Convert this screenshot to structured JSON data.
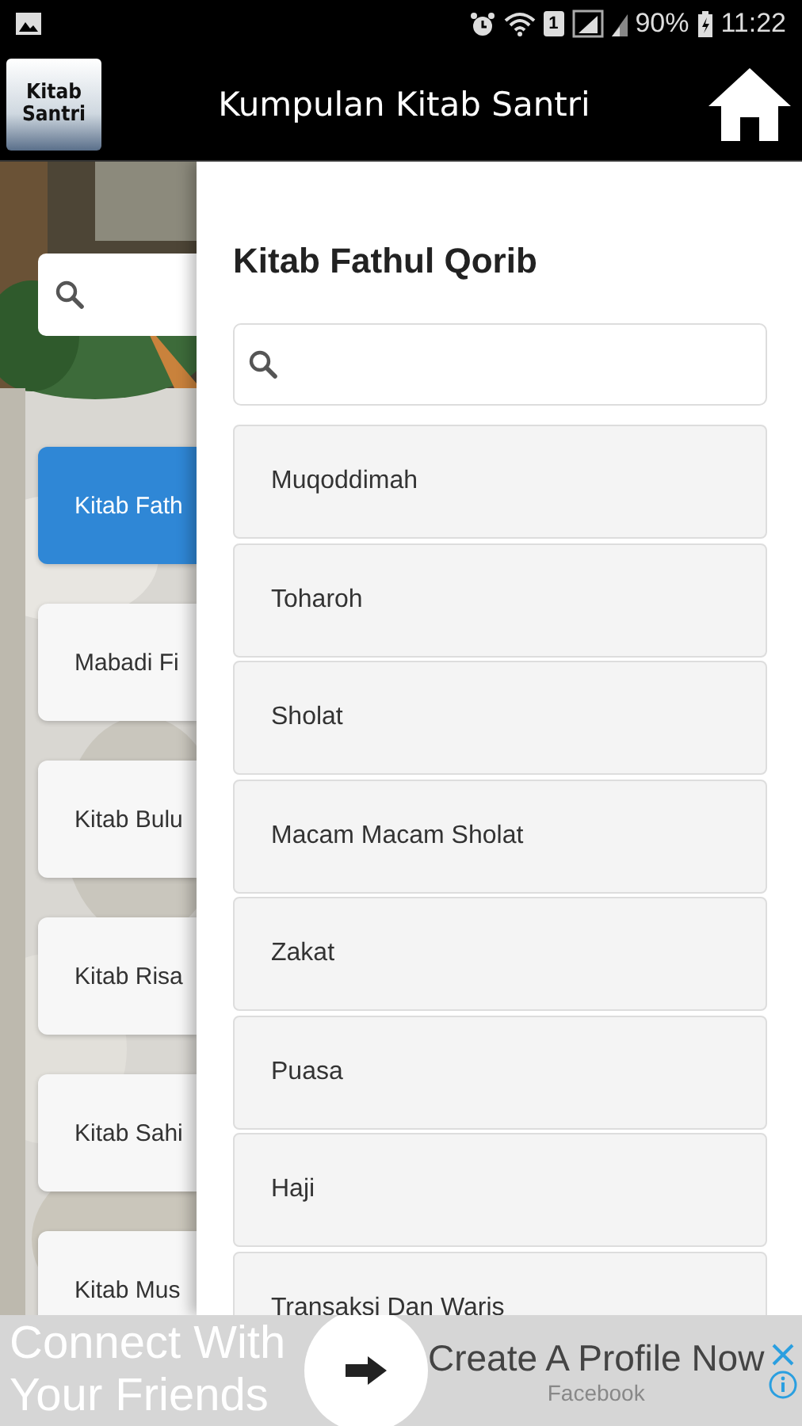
{
  "status_bar": {
    "sim_slot": "1",
    "battery": "90%",
    "time": "11:22"
  },
  "app_bar": {
    "logo_lines": [
      "Kitab",
      "Santri"
    ],
    "title": "Kumpulan Kitab Santri"
  },
  "books": [
    {
      "label": "Kitab Fath",
      "selected": true
    },
    {
      "label": "Mabadi Fi",
      "selected": false
    },
    {
      "label": "Kitab Bulu",
      "selected": false
    },
    {
      "label": "Kitab Risa",
      "selected": false
    },
    {
      "label": "Kitab Sahi",
      "selected": false
    },
    {
      "label": "Kitab Mus",
      "selected": false
    }
  ],
  "drawer": {
    "title": "Kitab Fathul Qorib",
    "chapters": [
      "Muqoddimah",
      "Toharoh",
      "Sholat",
      "Macam Macam Sholat",
      "Zakat",
      "Puasa",
      "Haji",
      "Transaksi Dan Waris"
    ]
  },
  "ad": {
    "headline": "Connect With Your Friends",
    "cta": "Create A Profile Now",
    "advertiser": "Facebook"
  }
}
